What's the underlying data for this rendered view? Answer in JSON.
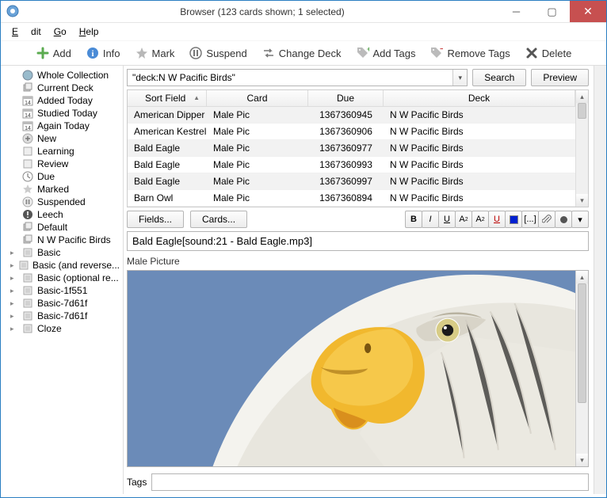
{
  "window": {
    "title": "Browser (123 cards shown; 1 selected)"
  },
  "menu": {
    "edit": "Edit",
    "go": "Go",
    "help": "Help"
  },
  "toolbar": {
    "add": "Add",
    "info": "Info",
    "mark": "Mark",
    "suspend": "Suspend",
    "change_deck": "Change Deck",
    "add_tags": "Add Tags",
    "remove_tags": "Remove Tags",
    "delete": "Delete"
  },
  "sidebar": {
    "items": [
      {
        "label": "Whole Collection",
        "icon": "globe",
        "expandable": false
      },
      {
        "label": "Current Deck",
        "icon": "cards",
        "expandable": false
      },
      {
        "label": "Added Today",
        "icon": "cal14",
        "expandable": false
      },
      {
        "label": "Studied Today",
        "icon": "cal14",
        "expandable": false
      },
      {
        "label": "Again Today",
        "icon": "cal14",
        "expandable": false
      },
      {
        "label": "New",
        "icon": "plus-circle",
        "expandable": false
      },
      {
        "label": "Learning",
        "icon": "square",
        "expandable": false
      },
      {
        "label": "Review",
        "icon": "square",
        "expandable": false
      },
      {
        "label": "Due",
        "icon": "clock",
        "expandable": false
      },
      {
        "label": "Marked",
        "icon": "star",
        "expandable": false
      },
      {
        "label": "Suspended",
        "icon": "pause-circle",
        "expandable": false
      },
      {
        "label": "Leech",
        "icon": "bang-circle",
        "expandable": false
      },
      {
        "label": "Default",
        "icon": "cards",
        "expandable": false
      },
      {
        "label": "N W Pacific Birds",
        "icon": "cards",
        "expandable": false
      },
      {
        "label": "Basic",
        "icon": "note",
        "expandable": true
      },
      {
        "label": "Basic (and reverse...",
        "icon": "note",
        "expandable": true
      },
      {
        "label": "Basic (optional re...",
        "icon": "note",
        "expandable": true
      },
      {
        "label": "Basic-1f551",
        "icon": "note",
        "expandable": true
      },
      {
        "label": "Basic-7d61f",
        "icon": "note",
        "expandable": true
      },
      {
        "label": "Basic-7d61f",
        "icon": "note",
        "expandable": true
      },
      {
        "label": "Cloze",
        "icon": "note",
        "expandable": true
      }
    ]
  },
  "search": {
    "query": "\"deck:N W Pacific Birds\"",
    "search_btn": "Search",
    "preview_btn": "Preview"
  },
  "table": {
    "headers": {
      "sort_field": "Sort Field",
      "card": "Card",
      "due": "Due",
      "deck": "Deck"
    },
    "rows": [
      {
        "sort_field": "American Dipper",
        "card": "Male Pic",
        "due": "1367360945",
        "deck": "N W Pacific Birds"
      },
      {
        "sort_field": "American Kestrel",
        "card": "Male Pic",
        "due": "1367360906",
        "deck": "N W Pacific Birds"
      },
      {
        "sort_field": "Bald Eagle",
        "card": "Male Pic",
        "due": "1367360977",
        "deck": "N W Pacific Birds"
      },
      {
        "sort_field": "Bald Eagle",
        "card": "Male Pic",
        "due": "1367360993",
        "deck": "N W Pacific Birds"
      },
      {
        "sort_field": "Bald Eagle",
        "card": "Male Pic",
        "due": "1367360997",
        "deck": "N W Pacific Birds"
      },
      {
        "sort_field": "Barn Owl",
        "card": "Male Pic",
        "due": "1367360894",
        "deck": "N W Pacific Birds"
      }
    ]
  },
  "editor": {
    "fields_btn": "Fields...",
    "cards_btn": "Cards...",
    "front_value": "Bald Eagle[sound:21 - Bald Eagle.mp3]",
    "picture_label": "Male Picture",
    "tags_label": "Tags",
    "tags_value": ""
  },
  "fmt_buttons": [
    "B",
    "I",
    "U",
    "A²",
    "A₂",
    "U",
    "■",
    "[...]",
    "📎",
    "●",
    "▾"
  ]
}
